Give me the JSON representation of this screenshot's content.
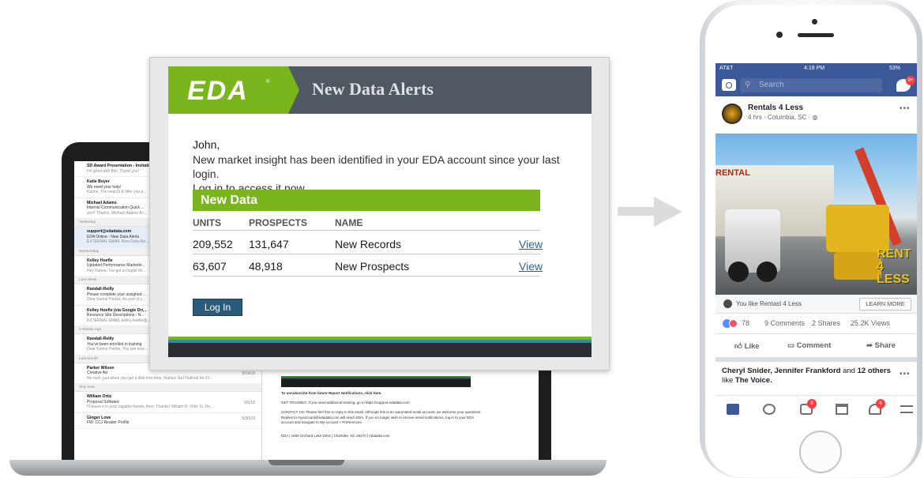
{
  "email": {
    "logo_text": "EDA",
    "logo_reg": "®",
    "title": "New Data Alerts",
    "greeting": "John,",
    "message_line1": "New market insight has been identified in your EDA account since your last login.",
    "login_link": "Log in",
    "message_line2_rest": " to access it now.",
    "section_title": "New Data",
    "columns": [
      "UNITS",
      "PROSPECTS",
      "NAME"
    ],
    "rows": [
      {
        "units": "209,552",
        "prospects": "131,647",
        "name": "New Records",
        "link": "View"
      },
      {
        "units": "63,607",
        "prospects": "48,918",
        "name": "New Prospects",
        "link": "View"
      }
    ],
    "button_label": "Log In",
    "colors": {
      "green": "#7ab51d",
      "header": "#505962",
      "button": "#2a5a7c",
      "link": "#2a6496"
    }
  },
  "laptop": {
    "mail_items": [
      {
        "type": "row",
        "from": "SD Award Presentation - Invitation",
        "preview": "I'm good with this. Thank you!"
      },
      {
        "type": "row",
        "from": "Katie Boyer",
        "subject": "We need your help!",
        "preview": "Karine, The search & filter you p..."
      },
      {
        "type": "row",
        "from": "Michael Adams",
        "subject": "Internal Communication Quick ...",
        "preview": "yes!! Thanks, Michael Adams Ac..."
      },
      {
        "type": "section",
        "label": "Yesterday"
      },
      {
        "type": "row",
        "selected": true,
        "from": "support@edadata.com",
        "subject": "EDA Online - New Data Alerts",
        "preview": "EXTERNAL EMAIL New Data Ale..."
      },
      {
        "type": "section",
        "label": "Wednesday"
      },
      {
        "type": "row",
        "from": "Kelley Hoefle",
        "subject": "Updated Performance Marketin...",
        "preview": "Hey Karine, I've got a couple thi..."
      },
      {
        "type": "section",
        "label": "Last Week"
      },
      {
        "type": "row",
        "from": "Randall-Reilly",
        "subject": "Please complete your assigned ...",
        "preview": "Dear Karine Parker, As part of y..."
      },
      {
        "type": "row",
        "from": "Kelley Hoefle (via Google Dri...",
        "subject": "Resource Site Descriptions - N...",
        "preview": "EXTERNAL EMAIL kelley.hoefle@..."
      },
      {
        "type": "section",
        "label": "2 Weeks Ago"
      },
      {
        "type": "row",
        "from": "Randall-Reilly",
        "subject": "You've been enrolled in training",
        "preview": "Dear Karine Parker, You are now ..."
      },
      {
        "type": "section",
        "label": "Last Month"
      },
      {
        "type": "row",
        "from": "Parker Wilson",
        "subject": "Creative Ad",
        "preview": "No rush, just when you get a little free time, thanks! Get Outlook for iO...",
        "date": "8/14/18"
      },
      {
        "type": "section",
        "label": "This Year"
      },
      {
        "type": "row",
        "from": "William Ortiz",
        "subject": "Proposal Software",
        "preview": "I'll leave it in your capable hands, then. Thanks! William R. Ortiz Sr. Dir...",
        "date": "6/6/18"
      },
      {
        "type": "row",
        "from": "Ginger Love",
        "subject": "FW: CCJ Reader Profile",
        "preview": "",
        "date": "5/30/18"
      }
    ],
    "footer_unsubscribe": "To unsubscribe from future Report Notifications, click here.",
    "footer_training": "GET TRAINING: If you need additional training, go to https://support.edadata.com",
    "footer_contact": "CONTACT US: Please feel free to reply to this email. Although this is an automated email account, we welcome your questions. Replies to myaccount@edadata.com will reach EDA. If you no longer wish to receive email notifications, log in to your EDA account and navigate to My Account > Preferences.",
    "footer_address": "EDA | 1509 Orchard Lake Drive | Charlotte, NC 28270 | edadata.com"
  },
  "phone": {
    "status_carrier": "AT&T",
    "status_time": "4:18 PM",
    "status_battery": "53%",
    "search_placeholder": "Search",
    "messenger_badge": "9+",
    "page_name": "Rentals 4 Less",
    "page_meta": "4 hrs · Columbia, SC · ",
    "image_sign": "RENTAL",
    "image_overlay_line1": "RENT 4",
    "image_overlay_line2": "LESS",
    "cta_text": "You like Rentasl 4 Less",
    "cta_button": "LEARN MORE",
    "reactions_count": "78",
    "comments": "9 Comments",
    "shares": "2 Shares",
    "views": "25.2K Views",
    "action_like": "Like",
    "action_comment": "Comment",
    "action_share": "Share",
    "friends_names": "Cheryl Snider, Jennifer Frankford",
    "friends_and": " and ",
    "friends_others": "12 others",
    "friends_like": "like ",
    "friends_page": "The Voice.",
    "tab_badges": [
      "9",
      "6"
    ],
    "colors": {
      "fb_blue": "#3b5998"
    }
  }
}
